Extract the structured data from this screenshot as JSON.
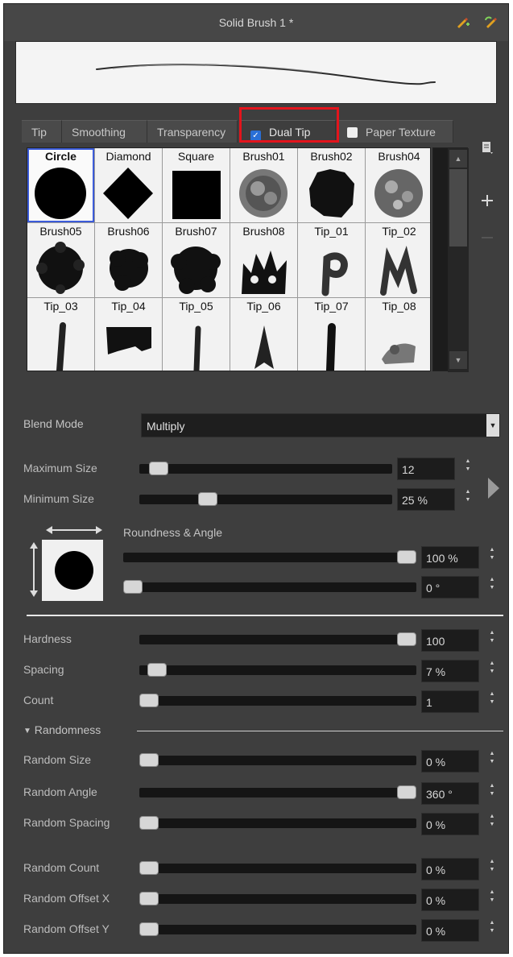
{
  "window": {
    "title": "Solid Brush 1 *",
    "icons": [
      "pencil-plus-icon",
      "pencil-refresh-icon"
    ]
  },
  "tabs": [
    {
      "label": "Tip",
      "active": false
    },
    {
      "label": "Smoothing",
      "active": false
    },
    {
      "label": "Transparency",
      "active": false
    },
    {
      "label": "Dual Tip",
      "active": true,
      "checked": true
    },
    {
      "label": "Paper Texture",
      "active": false,
      "checked": false
    }
  ],
  "tips": [
    {
      "label": "Circle",
      "shape": "circle",
      "selected": true
    },
    {
      "label": "Diamond",
      "shape": "diamond"
    },
    {
      "label": "Square",
      "shape": "square"
    },
    {
      "label": "Brush01",
      "shape": "soft-scribble"
    },
    {
      "label": "Brush02",
      "shape": "rough-blot"
    },
    {
      "label": "Brush04",
      "shape": "textured-disc"
    },
    {
      "label": "Brush05",
      "shape": "fuzzy-blob"
    },
    {
      "label": "Brush06",
      "shape": "bumpy-blob"
    },
    {
      "label": "Brush07",
      "shape": "cloud-blob"
    },
    {
      "label": "Brush08",
      "shape": "spiky-crown"
    },
    {
      "label": "Tip_01",
      "shape": "p-stroke"
    },
    {
      "label": "Tip_02",
      "shape": "m-stroke"
    },
    {
      "label": "Tip_03",
      "shape": "thin-stroke"
    },
    {
      "label": "Tip_04",
      "shape": "wide-stroke"
    },
    {
      "label": "Tip_05",
      "shape": "narrow-stroke"
    },
    {
      "label": "Tip_06",
      "shape": "arrow-stroke"
    },
    {
      "label": "Tip_07",
      "shape": "dash-stroke"
    },
    {
      "label": "Tip_08",
      "shape": "smudge-stroke"
    }
  ],
  "blend": {
    "label": "Blend Mode",
    "value": "Multiply"
  },
  "size": {
    "max": {
      "label": "Maximum Size",
      "value": "12",
      "level": 0.04
    },
    "min": {
      "label": "Minimum Size",
      "value": "25 %",
      "level": 0.25
    }
  },
  "roundness": {
    "label": "Roundness & Angle",
    "roundness_value": "100 %",
    "roundness_level": 1.0,
    "angle_value": "0 °",
    "angle_level": 0.0
  },
  "params": [
    {
      "label": "Hardness",
      "value": "100",
      "level": 1.0
    },
    {
      "label": "Spacing",
      "value": "7 %",
      "level": 0.03
    },
    {
      "label": "Count",
      "value": "1",
      "level": 0.0
    }
  ],
  "randomness": {
    "label": "Randomness",
    "items": [
      {
        "label": "Random Size",
        "value": "0 %",
        "level": 0.0
      },
      {
        "label": "Random Angle",
        "value": "360 °",
        "level": 1.0
      },
      {
        "label": "Random Spacing",
        "value": "0 %",
        "level": 0.0
      },
      {
        "label": "Random Count",
        "value": "0 %",
        "level": 0.0
      },
      {
        "label": "Random Offset X",
        "value": "0 %",
        "level": 0.0
      },
      {
        "label": "Random Offset Y",
        "value": "0 %",
        "level": 0.0
      }
    ]
  },
  "colors": {
    "highlight": "#e3141c",
    "selection": "#3b5bd9",
    "check": "#2a6fd6"
  }
}
